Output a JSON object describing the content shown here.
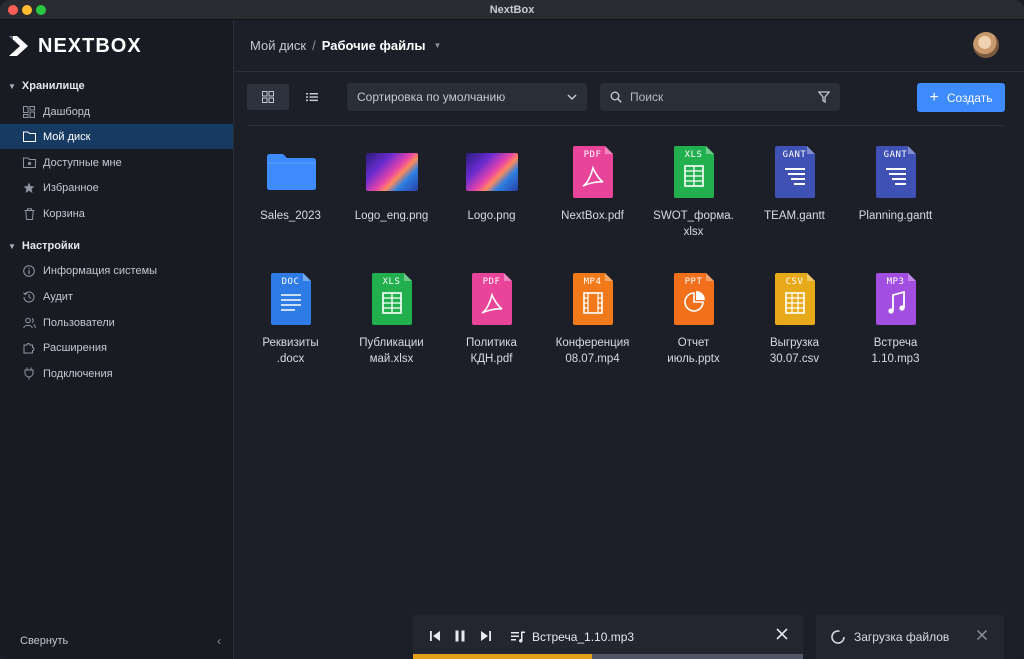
{
  "window": {
    "title": "NextBox"
  },
  "brand": {
    "name": "NEXTBOX"
  },
  "sidebar": {
    "storage_section": "Хранилище",
    "storage_items": [
      {
        "label": "Дашборд",
        "icon": "dashboard-icon"
      },
      {
        "label": "Мой диск",
        "icon": "folder-icon",
        "active": true
      },
      {
        "label": "Доступные мне",
        "icon": "shared-folder-icon"
      },
      {
        "label": "Избранное",
        "icon": "star-icon"
      },
      {
        "label": "Корзина",
        "icon": "trash-icon"
      }
    ],
    "settings_section": "Настройки",
    "settings_items": [
      {
        "label": "Информация системы",
        "icon": "info-icon"
      },
      {
        "label": "Аудит",
        "icon": "history-icon"
      },
      {
        "label": "Пользователи",
        "icon": "users-icon"
      },
      {
        "label": "Расширения",
        "icon": "puzzle-icon"
      },
      {
        "label": "Подключения",
        "icon": "plug-icon"
      }
    ],
    "collapse_label": "Свернуть"
  },
  "header": {
    "breadcrumb_root": "Мой диск",
    "breadcrumb_separator": "/",
    "breadcrumb_current": "Рабочие файлы"
  },
  "toolbar": {
    "sort_label": "Сортировка по умолчанию",
    "search_placeholder": "Поиск",
    "create_label": "Создать"
  },
  "files": [
    {
      "name": "Sales_2023",
      "type": "folder"
    },
    {
      "name": "Logo_eng.png",
      "type": "image"
    },
    {
      "name": "Logo.png",
      "type": "image"
    },
    {
      "name": "NextBox.pdf",
      "type": "pdf",
      "tag": "PDF",
      "color": "#e8459a"
    },
    {
      "name": "SWOT_форма.\nxlsx",
      "type": "xls",
      "tag": "XLS",
      "color": "#22b04f"
    },
    {
      "name": "TEAM.gantt",
      "type": "gantt",
      "tag": "GANT",
      "color": "#3f51b5"
    },
    {
      "name": "Planning.gantt",
      "type": "gantt",
      "tag": "GANT",
      "color": "#3f51b5"
    },
    {
      "name": "Реквизиты\n.docx",
      "type": "doc",
      "tag": "DOC",
      "color": "#2f7be5"
    },
    {
      "name": "Публикации\nмай.xlsx",
      "type": "xls",
      "tag": "XLS",
      "color": "#22b04f"
    },
    {
      "name": "Политика\nКДН.pdf",
      "type": "pdf",
      "tag": "PDF",
      "color": "#e8459a"
    },
    {
      "name": "Конференция\n08.07.mp4",
      "type": "mp4",
      "tag": "MP4",
      "color": "#f07a1a"
    },
    {
      "name": "Отчет\nиюль.pptx",
      "type": "ppt",
      "tag": "PPT",
      "color": "#f2701c"
    },
    {
      "name": "Выгрузка\n30.07.csv",
      "type": "csv",
      "tag": "CSV",
      "color": "#e8a91a"
    },
    {
      "name": "Встреча\n1.10.mp3",
      "type": "mp3",
      "tag": "MP3",
      "color": "#a24ee0"
    }
  ],
  "player": {
    "track": "Встреча_1.10.mp3",
    "progress": 0.46,
    "accent": "#e4a11b"
  },
  "upload": {
    "label": "Загрузка файлов"
  }
}
